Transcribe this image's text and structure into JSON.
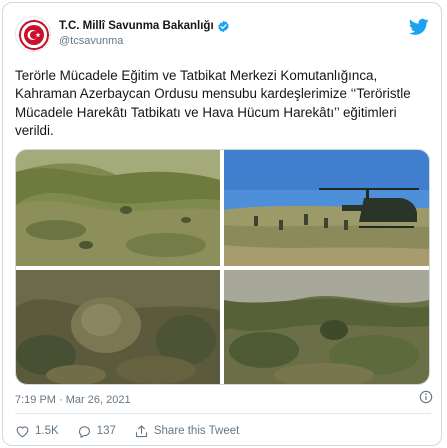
{
  "account": {
    "display_name": "T.C. Millî Savunma Bakanlığı",
    "handle": "@tcsavunma",
    "avatar_icon": "ministry-seal-icon",
    "verified_icon": "verified-badge-icon"
  },
  "tweet": {
    "text": "Terörle Mücadele Eğitim ve Tatbikat Merkezi Komutanlığınca, Kahraman Azerbaycan Ordusu mensubu kardeşlerimize ‘‘Teröristle Mücadele Harekâtı Tatbikatı ve Hava Hücum Harekâtı’’ eğitimleri verildi.",
    "timestamp": "7:19 PM · Mar 26, 2021",
    "photos": [
      {
        "name": "photo-hillside-soldiers",
        "scene": "hillside"
      },
      {
        "name": "photo-helicopter-landing",
        "scene": "helicopter"
      },
      {
        "name": "photo-camouflaged-soldier",
        "scene": "camouflage"
      },
      {
        "name": "photo-rocky-slope",
        "scene": "slope"
      }
    ]
  },
  "actions": {
    "like_count": "1.5K",
    "reply_count": "137",
    "share_label": "Share this Tweet"
  },
  "colors": {
    "brand_blue": "#1da1f2",
    "text": "#14171a",
    "muted": "#657786",
    "border": "#cfd9de",
    "seal_red": "#c8102e"
  }
}
